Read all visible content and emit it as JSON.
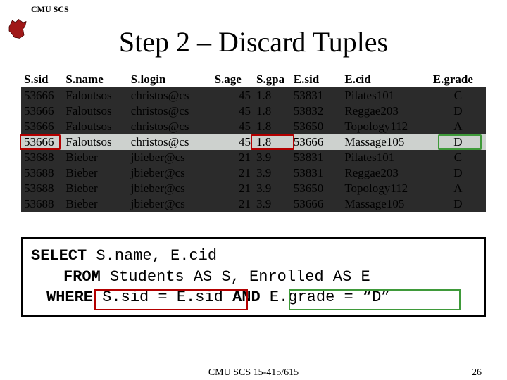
{
  "header": {
    "label": "CMU SCS"
  },
  "title": "Step 2 – Discard Tuples",
  "columns": [
    "S.sid",
    "S.name",
    "S.login",
    "S.age",
    "S.gpa",
    "E.sid",
    "E.cid",
    "E.grade"
  ],
  "rows": [
    {
      "sid": "53666",
      "name": "Faloutsos",
      "login": "christos@cs",
      "age": "45",
      "gpa": "1.8",
      "esid": "53831",
      "ecid": "Pilates101",
      "grade": "C",
      "kept": false
    },
    {
      "sid": "53666",
      "name": "Faloutsos",
      "login": "christos@cs",
      "age": "45",
      "gpa": "1.8",
      "esid": "53832",
      "ecid": "Reggae203",
      "grade": "D",
      "kept": false
    },
    {
      "sid": "53666",
      "name": "Faloutsos",
      "login": "christos@cs",
      "age": "45",
      "gpa": "1.8",
      "esid": "53650",
      "ecid": "Topology112",
      "grade": "A",
      "kept": false
    },
    {
      "sid": "53666",
      "name": "Faloutsos",
      "login": "christos@cs",
      "age": "45",
      "gpa": "1.8",
      "esid": "53666",
      "ecid": "Massage105",
      "grade": "D",
      "kept": true
    },
    {
      "sid": "53688",
      "name": "Bieber",
      "login": "jbieber@cs",
      "age": "21",
      "gpa": "3.9",
      "esid": "53831",
      "ecid": "Pilates101",
      "grade": "C",
      "kept": false
    },
    {
      "sid": "53688",
      "name": "Bieber",
      "login": "jbieber@cs",
      "age": "21",
      "gpa": "3.9",
      "esid": "53831",
      "ecid": "Reggae203",
      "grade": "D",
      "kept": false
    },
    {
      "sid": "53688",
      "name": "Bieber",
      "login": "jbieber@cs",
      "age": "21",
      "gpa": "3.9",
      "esid": "53650",
      "ecid": "Topology112",
      "grade": "A",
      "kept": false
    },
    {
      "sid": "53688",
      "name": "Bieber",
      "login": "jbieber@cs",
      "age": "21",
      "gpa": "3.9",
      "esid": "53666",
      "ecid": "Massage105",
      "grade": "D",
      "kept": false
    }
  ],
  "sql": {
    "line1_kw": "SELECT",
    "line1_rest": " S.name, E.cid",
    "line2_kw": "FROM",
    "line2_rest": " Students AS S, Enrolled AS E",
    "line3_kw": "WHERE",
    "line3_mid": " S.sid = E.sid ",
    "line3_and": "AND",
    "line3_end": " E.grade = “D”"
  },
  "footer": {
    "center": "CMU SCS 15-415/615",
    "page": "26"
  }
}
